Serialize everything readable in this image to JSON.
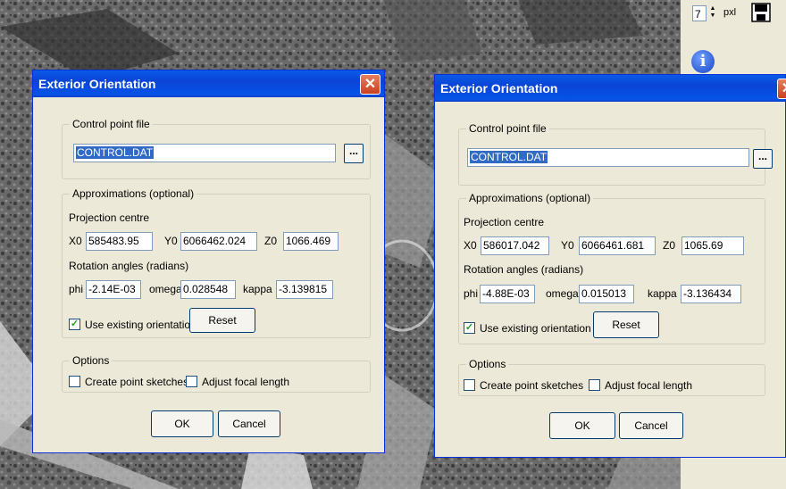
{
  "toolbar": {
    "spin_value": "7",
    "unit_label": "pxl"
  },
  "dialogs": [
    {
      "title": "Exterior Orientation",
      "close_label": "✕",
      "control_group": "Control point file",
      "control_file": "CONTROL.DAT",
      "browse_label": "...",
      "approx_group": "Approximations (optional)",
      "projection_label": "Projection centre",
      "x0_label": "X0",
      "x0": "585483.95",
      "y0_label": "Y0",
      "y0": "6066462.024",
      "z0_label": "Z0",
      "z0": "1066.469",
      "rotation_label": "Rotation angles (radians)",
      "phi_label": "phi",
      "phi": "-2.14E-03",
      "omega_label": "omega",
      "omega": "0.028548",
      "kappa_label": "kappa",
      "kappa": "-3.139815",
      "use_existing_label": "Use existing orientation",
      "use_existing_checked": true,
      "reset_label": "Reset",
      "options_group": "Options",
      "sketches_label": "Create point sketches",
      "focal_label": "Adjust focal length",
      "ok_label": "OK",
      "cancel_label": "Cancel"
    },
    {
      "title": "Exterior Orientation",
      "close_label": "✕",
      "control_group": "Control point file",
      "control_file": "CONTROL.DAT",
      "browse_label": "...",
      "approx_group": "Approximations (optional)",
      "projection_label": "Projection centre",
      "x0_label": "X0",
      "x0": "586017.042",
      "y0_label": "Y0",
      "y0": "6066461.681",
      "z0_label": "Z0",
      "z0": "1065.69",
      "rotation_label": "Rotation angles (radians)",
      "phi_label": "phi",
      "phi": "-4.88E-03",
      "omega_label": "omega",
      "omega": "0.015013",
      "kappa_label": "kappa",
      "kappa": "-3.136434",
      "use_existing_label": "Use existing orientation",
      "use_existing_checked": true,
      "reset_label": "Reset",
      "options_group": "Options",
      "sketches_label": "Create point sketches",
      "focal_label": "Adjust focal length",
      "ok_label": "OK",
      "cancel_label": "Cancel"
    }
  ]
}
